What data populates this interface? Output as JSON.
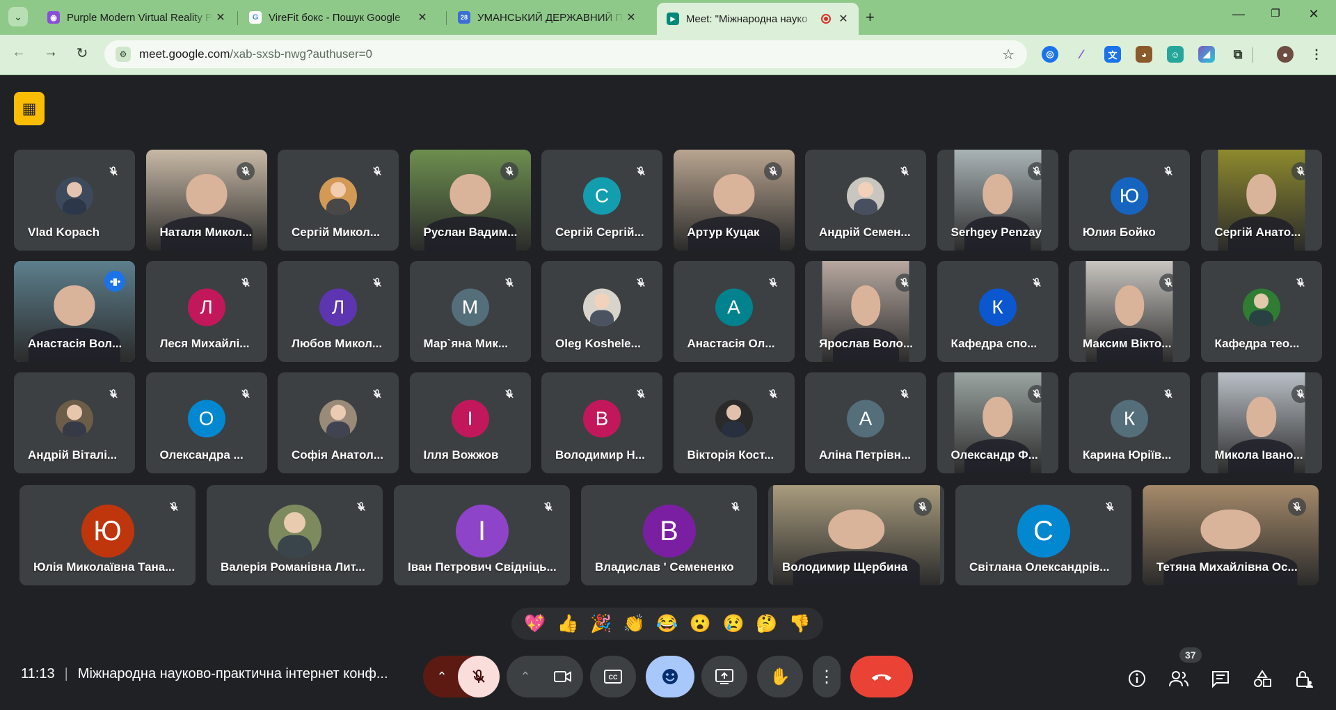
{
  "browser": {
    "tabs": [
      {
        "title": "Purple Modern Virtual Reality P",
        "favicon_color": "#8a4fd8",
        "favicon_glyph": "◉"
      },
      {
        "title": "VireFit бокс - Пошук Google",
        "favicon_color": "#ffffff",
        "favicon_glyph": "G"
      },
      {
        "title": "УМАНСЬКИЙ ДЕРЖАВНИЙ ПЕ",
        "favicon_color": "#3b6fd6",
        "favicon_glyph": "28"
      },
      {
        "title": "Meet: \"Міжнародна науко",
        "favicon_color": "#00897b",
        "favicon_glyph": "▶"
      }
    ],
    "url_host": "meet.google.com",
    "url_path": "/xab-sxsb-nwg?authuser=0"
  },
  "participants": [
    {
      "name": "Vlad Kopach",
      "type": "photo",
      "color": "#3d4a5c",
      "muted": true
    },
    {
      "name": "Наталя Микол...",
      "type": "video",
      "color": "#c8b9a6",
      "muted": true
    },
    {
      "name": "Сергій Микол...",
      "type": "photo",
      "color": "#d29a55",
      "muted": true
    },
    {
      "name": "Руслан Вадим...",
      "type": "video",
      "color": "#6d8f4f",
      "muted": true
    },
    {
      "name": "Сергій Сергій...",
      "type": "initial",
      "initial": "С",
      "color": "#129eaf",
      "muted": true
    },
    {
      "name": "Артур Куцак",
      "type": "video",
      "color": "#b9a590",
      "muted": true
    },
    {
      "name": "Андрій Семен...",
      "type": "photo",
      "color": "#c9c6c0",
      "muted": true
    },
    {
      "name": "Serhgey Penzay",
      "type": "video",
      "color": "#a9b3b6",
      "muted": true
    },
    {
      "name": "Юлия Бойко",
      "type": "initial",
      "initial": "Ю",
      "color": "#1565c0",
      "muted": true
    },
    {
      "name": "Сергій Анато...",
      "type": "video",
      "color": "#8e8a2e",
      "muted": true
    },
    {
      "name": "Анастасія Вол...",
      "type": "video",
      "color": "#5c7f8c",
      "muted": false,
      "speaking": true
    },
    {
      "name": "Леся Михайлі...",
      "type": "initial",
      "initial": "Л",
      "color": "#c2185b",
      "muted": true
    },
    {
      "name": "Любов Микол...",
      "type": "initial",
      "initial": "Л",
      "color": "#5e35b1",
      "muted": true
    },
    {
      "name": "Мар`яна Мик...",
      "type": "initial",
      "initial": "М",
      "color": "#546e7a",
      "muted": true
    },
    {
      "name": "Oleg Koshele...",
      "type": "photo",
      "color": "#d8d4cc",
      "muted": true
    },
    {
      "name": "Анастасія Ол...",
      "type": "initial",
      "initial": "А",
      "color": "#00838f",
      "muted": true
    },
    {
      "name": "Ярослав Воло...",
      "type": "video",
      "color": "#b7a8a0",
      "muted": true
    },
    {
      "name": "Кафедра спо...",
      "type": "initial",
      "initial": "К",
      "color": "#0b57d0",
      "muted": true
    },
    {
      "name": "Максим Вікто...",
      "type": "video",
      "color": "#c8c5c0",
      "muted": true
    },
    {
      "name": "Кафедра тео...",
      "type": "photo",
      "color": "#2e7d32",
      "muted": true
    },
    {
      "name": "Андрій Віталі...",
      "type": "photo",
      "color": "#6b5d48",
      "muted": true
    },
    {
      "name": "Олександра ...",
      "type": "initial",
      "initial": "О",
      "color": "#0288d1",
      "muted": true
    },
    {
      "name": "Софія Анатол...",
      "type": "photo",
      "color": "#9a8a78",
      "muted": true
    },
    {
      "name": "Ілля Вожжов",
      "type": "initial",
      "initial": "І",
      "color": "#c2185b",
      "muted": true
    },
    {
      "name": "Володимир Н...",
      "type": "initial",
      "initial": "В",
      "color": "#c2185b",
      "muted": true
    },
    {
      "name": "Вікторія Кост...",
      "type": "photo",
      "color": "#2a2a2a",
      "muted": true
    },
    {
      "name": "Аліна Петрівн...",
      "type": "initial",
      "initial": "А",
      "color": "#546e7a",
      "muted": true
    },
    {
      "name": "Олександр Ф...",
      "type": "video",
      "color": "#9aa4a0",
      "muted": true
    },
    {
      "name": "Карина Юріїв...",
      "type": "initial",
      "initial": "К",
      "color": "#546e7a",
      "muted": true
    },
    {
      "name": "Микола Івано...",
      "type": "video",
      "color": "#b9bfc6",
      "muted": true
    },
    {
      "name": "Юлія Миколаївна Тана...",
      "type": "initial",
      "initial": "Ю",
      "color": "#bf360c",
      "muted": true
    },
    {
      "name": "Валерія Романівна Лит...",
      "type": "photo",
      "color": "#7d8a5e",
      "muted": true
    },
    {
      "name": "Іван Петрович Свідніць...",
      "type": "initial",
      "initial": "І",
      "color": "#8e44c9",
      "muted": true
    },
    {
      "name": "Владислав ' Семененко",
      "type": "initial",
      "initial": "В",
      "color": "#7b1fa2",
      "muted": true
    },
    {
      "name": "Володимир Щербина",
      "type": "video",
      "color": "#a99c7e",
      "muted": true
    },
    {
      "name": "Світлана Олександрів...",
      "type": "initial",
      "initial": "С",
      "color": "#0288d1",
      "muted": true
    },
    {
      "name": "Тетяна Михайлівна Ос...",
      "type": "video",
      "color": "#a58a6a",
      "muted": true
    }
  ],
  "reactions": [
    "💖",
    "👍",
    "🎉",
    "👏",
    "😂",
    "😮",
    "😢",
    "🤔",
    "👎"
  ],
  "meeting": {
    "time": "11:13",
    "title": "Міжнародна науково-практична інтернет конф...",
    "participant_count": "37"
  },
  "colors": {
    "meet_bg": "#202124",
    "tile_bg": "#3c4043",
    "mic_off_bg": "#f9dedc",
    "reaction_active": "#a8c7fa",
    "leave_red": "#ea4335"
  }
}
